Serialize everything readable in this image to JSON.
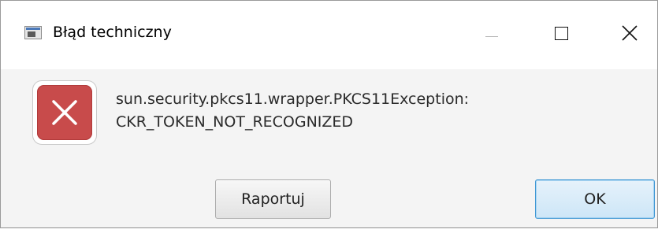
{
  "window": {
    "title": "Błąd techniczny",
    "controls": {
      "minimize_icon": "minimize-icon",
      "maximize_icon": "maximize-icon",
      "close_icon": "close-icon"
    }
  },
  "dialog": {
    "icon": "error-icon",
    "message_line1": "sun.security.pkcs11.wrapper.PKCS11Exception:",
    "message_line2": "CKR_TOKEN_NOT_RECOGNIZED"
  },
  "buttons": {
    "report_label": "Raportuj",
    "ok_label": "OK"
  },
  "colors": {
    "error_red": "#c84b4b",
    "default_button_border": "#3c96d4"
  }
}
